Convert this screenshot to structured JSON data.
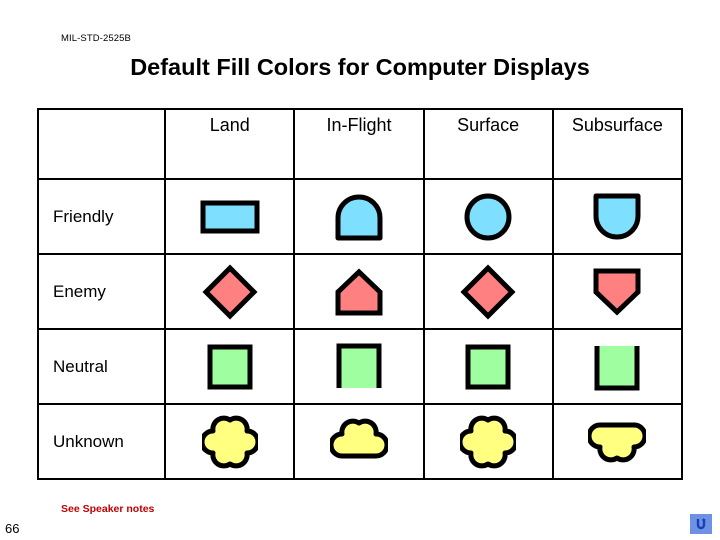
{
  "slide": {
    "standard_reference": "MIL-STD-2525B",
    "title": "Default Fill Colors for Computer Displays",
    "speaker_notes_label": "See Speaker notes",
    "page_number": "66",
    "return_button_icon": "return-arrow-icon"
  },
  "colors": {
    "friendly_fill": "#7FDFFF",
    "enemy_fill": "#FF8080",
    "neutral_fill": "#9FFFA0",
    "unknown_fill": "#FFFF80",
    "outline": "#000000",
    "notes_text": "#C00000",
    "button_background": "#6E91E8"
  },
  "table": {
    "corner_header": "",
    "column_headers": [
      {
        "label": "Land",
        "key": "land"
      },
      {
        "label": "In-Flight",
        "key": "in_flight"
      },
      {
        "label": "Surface",
        "key": "surface"
      },
      {
        "label": "Subsurface",
        "key": "subsurface"
      }
    ],
    "rows": [
      {
        "label": "Friendly",
        "fill": "#7FDFFF",
        "cells": [
          {
            "column": "Land",
            "shape": "rectangle",
            "icon_name": "friendly-land-symbol"
          },
          {
            "column": "In-Flight",
            "shape": "arch-up",
            "icon_name": "friendly-in-flight-symbol"
          },
          {
            "column": "Surface",
            "shape": "circle",
            "icon_name": "friendly-surface-symbol"
          },
          {
            "column": "Subsurface",
            "shape": "arch-down",
            "icon_name": "friendly-subsurface-symbol"
          }
        ]
      },
      {
        "label": "Enemy",
        "fill": "#FF8080",
        "cells": [
          {
            "column": "Land",
            "shape": "diamond",
            "icon_name": "enemy-land-symbol"
          },
          {
            "column": "In-Flight",
            "shape": "pentagon-up",
            "icon_name": "enemy-in-flight-symbol"
          },
          {
            "column": "Surface",
            "shape": "diamond",
            "icon_name": "enemy-surface-symbol"
          },
          {
            "column": "Subsurface",
            "shape": "pentagon-down",
            "icon_name": "enemy-subsurface-symbol"
          }
        ]
      },
      {
        "label": "Neutral",
        "fill": "#9FFFA0",
        "cells": [
          {
            "column": "Land",
            "shape": "square",
            "icon_name": "neutral-land-symbol"
          },
          {
            "column": "In-Flight",
            "shape": "square-open-bottom",
            "icon_name": "neutral-in-flight-symbol"
          },
          {
            "column": "Surface",
            "shape": "square",
            "icon_name": "neutral-surface-symbol"
          },
          {
            "column": "Subsurface",
            "shape": "square-open-top",
            "icon_name": "neutral-subsurface-symbol"
          }
        ]
      },
      {
        "label": "Unknown",
        "fill": "#FFFF80",
        "cells": [
          {
            "column": "Land",
            "shape": "quatrefoil",
            "icon_name": "unknown-land-symbol"
          },
          {
            "column": "In-Flight",
            "shape": "trefoil-up",
            "icon_name": "unknown-in-flight-symbol"
          },
          {
            "column": "Surface",
            "shape": "quatrefoil",
            "icon_name": "unknown-surface-symbol"
          },
          {
            "column": "Subsurface",
            "shape": "trefoil-down",
            "icon_name": "unknown-subsurface-symbol"
          }
        ]
      }
    ]
  }
}
